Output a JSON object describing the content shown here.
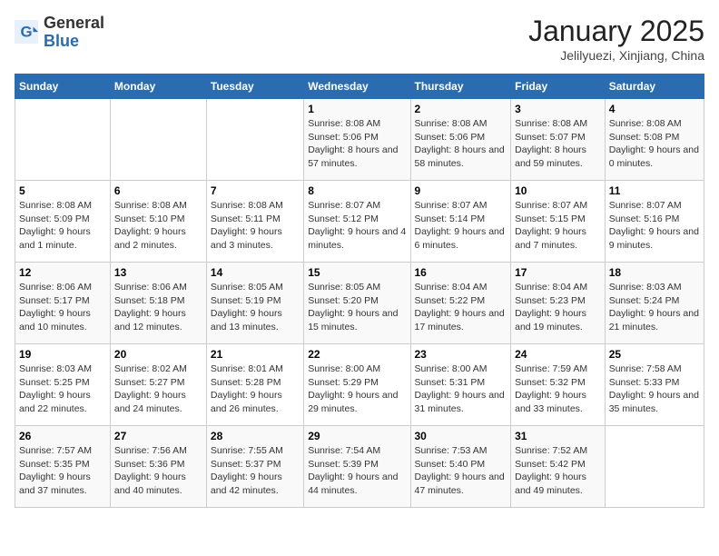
{
  "logo": {
    "general": "General",
    "blue": "Blue"
  },
  "title": "January 2025",
  "subtitle": "Jelilyuezi, Xinjiang, China",
  "weekdays": [
    "Sunday",
    "Monday",
    "Tuesday",
    "Wednesday",
    "Thursday",
    "Friday",
    "Saturday"
  ],
  "weeks": [
    [
      {
        "day": "",
        "info": ""
      },
      {
        "day": "",
        "info": ""
      },
      {
        "day": "",
        "info": ""
      },
      {
        "day": "1",
        "info": "Sunrise: 8:08 AM\nSunset: 5:06 PM\nDaylight: 8 hours and 57 minutes."
      },
      {
        "day": "2",
        "info": "Sunrise: 8:08 AM\nSunset: 5:06 PM\nDaylight: 8 hours and 58 minutes."
      },
      {
        "day": "3",
        "info": "Sunrise: 8:08 AM\nSunset: 5:07 PM\nDaylight: 8 hours and 59 minutes."
      },
      {
        "day": "4",
        "info": "Sunrise: 8:08 AM\nSunset: 5:08 PM\nDaylight: 9 hours and 0 minutes."
      }
    ],
    [
      {
        "day": "5",
        "info": "Sunrise: 8:08 AM\nSunset: 5:09 PM\nDaylight: 9 hours and 1 minute."
      },
      {
        "day": "6",
        "info": "Sunrise: 8:08 AM\nSunset: 5:10 PM\nDaylight: 9 hours and 2 minutes."
      },
      {
        "day": "7",
        "info": "Sunrise: 8:08 AM\nSunset: 5:11 PM\nDaylight: 9 hours and 3 minutes."
      },
      {
        "day": "8",
        "info": "Sunrise: 8:07 AM\nSunset: 5:12 PM\nDaylight: 9 hours and 4 minutes."
      },
      {
        "day": "9",
        "info": "Sunrise: 8:07 AM\nSunset: 5:14 PM\nDaylight: 9 hours and 6 minutes."
      },
      {
        "day": "10",
        "info": "Sunrise: 8:07 AM\nSunset: 5:15 PM\nDaylight: 9 hours and 7 minutes."
      },
      {
        "day": "11",
        "info": "Sunrise: 8:07 AM\nSunset: 5:16 PM\nDaylight: 9 hours and 9 minutes."
      }
    ],
    [
      {
        "day": "12",
        "info": "Sunrise: 8:06 AM\nSunset: 5:17 PM\nDaylight: 9 hours and 10 minutes."
      },
      {
        "day": "13",
        "info": "Sunrise: 8:06 AM\nSunset: 5:18 PM\nDaylight: 9 hours and 12 minutes."
      },
      {
        "day": "14",
        "info": "Sunrise: 8:05 AM\nSunset: 5:19 PM\nDaylight: 9 hours and 13 minutes."
      },
      {
        "day": "15",
        "info": "Sunrise: 8:05 AM\nSunset: 5:20 PM\nDaylight: 9 hours and 15 minutes."
      },
      {
        "day": "16",
        "info": "Sunrise: 8:04 AM\nSunset: 5:22 PM\nDaylight: 9 hours and 17 minutes."
      },
      {
        "day": "17",
        "info": "Sunrise: 8:04 AM\nSunset: 5:23 PM\nDaylight: 9 hours and 19 minutes."
      },
      {
        "day": "18",
        "info": "Sunrise: 8:03 AM\nSunset: 5:24 PM\nDaylight: 9 hours and 21 minutes."
      }
    ],
    [
      {
        "day": "19",
        "info": "Sunrise: 8:03 AM\nSunset: 5:25 PM\nDaylight: 9 hours and 22 minutes."
      },
      {
        "day": "20",
        "info": "Sunrise: 8:02 AM\nSunset: 5:27 PM\nDaylight: 9 hours and 24 minutes."
      },
      {
        "day": "21",
        "info": "Sunrise: 8:01 AM\nSunset: 5:28 PM\nDaylight: 9 hours and 26 minutes."
      },
      {
        "day": "22",
        "info": "Sunrise: 8:00 AM\nSunset: 5:29 PM\nDaylight: 9 hours and 29 minutes."
      },
      {
        "day": "23",
        "info": "Sunrise: 8:00 AM\nSunset: 5:31 PM\nDaylight: 9 hours and 31 minutes."
      },
      {
        "day": "24",
        "info": "Sunrise: 7:59 AM\nSunset: 5:32 PM\nDaylight: 9 hours and 33 minutes."
      },
      {
        "day": "25",
        "info": "Sunrise: 7:58 AM\nSunset: 5:33 PM\nDaylight: 9 hours and 35 minutes."
      }
    ],
    [
      {
        "day": "26",
        "info": "Sunrise: 7:57 AM\nSunset: 5:35 PM\nDaylight: 9 hours and 37 minutes."
      },
      {
        "day": "27",
        "info": "Sunrise: 7:56 AM\nSunset: 5:36 PM\nDaylight: 9 hours and 40 minutes."
      },
      {
        "day": "28",
        "info": "Sunrise: 7:55 AM\nSunset: 5:37 PM\nDaylight: 9 hours and 42 minutes."
      },
      {
        "day": "29",
        "info": "Sunrise: 7:54 AM\nSunset: 5:39 PM\nDaylight: 9 hours and 44 minutes."
      },
      {
        "day": "30",
        "info": "Sunrise: 7:53 AM\nSunset: 5:40 PM\nDaylight: 9 hours and 47 minutes."
      },
      {
        "day": "31",
        "info": "Sunrise: 7:52 AM\nSunset: 5:42 PM\nDaylight: 9 hours and 49 minutes."
      },
      {
        "day": "",
        "info": ""
      }
    ]
  ]
}
